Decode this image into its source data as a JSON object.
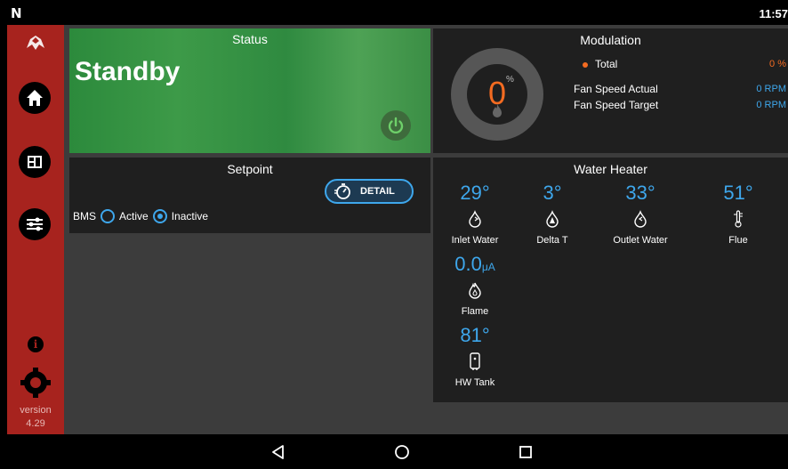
{
  "statusbar": {
    "logo": "N",
    "time": "11:57"
  },
  "sidebar": {
    "version_label": "version",
    "version_number": "4.29",
    "items": [
      {
        "name": "home",
        "icon": "home-icon"
      },
      {
        "name": "dashboard",
        "icon": "layout-icon"
      },
      {
        "name": "settings-sliders",
        "icon": "sliders-icon"
      }
    ]
  },
  "status": {
    "title": "Status",
    "value": "Standby"
  },
  "modulation": {
    "title": "Modulation",
    "dial_value": "0",
    "dial_unit": "%",
    "total_label": "Total",
    "total_value": "0 %",
    "fan_actual_label": "Fan Speed Actual",
    "fan_actual_value": "0 RPM",
    "fan_target_label": "Fan Speed Target",
    "fan_target_value": "0 RPM"
  },
  "setpoint": {
    "title": "Setpoint",
    "detail_label": "DETAIL",
    "bms_label": "BMS",
    "active_label": "Active",
    "inactive_label": "Inactive",
    "selected": "Inactive"
  },
  "water_heater": {
    "title": "Water Heater",
    "inlet": {
      "value": "29°",
      "label": "Inlet Water"
    },
    "delta": {
      "value": "3°",
      "label": "Delta T"
    },
    "outlet": {
      "value": "33°",
      "label": "Outlet Water"
    },
    "flue": {
      "value": "51°",
      "label": "Flue"
    },
    "flame": {
      "value": "0.0",
      "unit": "μA",
      "label": "Flame"
    },
    "tank": {
      "value": "81°",
      "label": "HW Tank"
    }
  },
  "colors": {
    "sidebar": "#a7231e",
    "accent": "#3ea7ec",
    "dial": "#f36b21",
    "status_green": "#3d9a48"
  }
}
